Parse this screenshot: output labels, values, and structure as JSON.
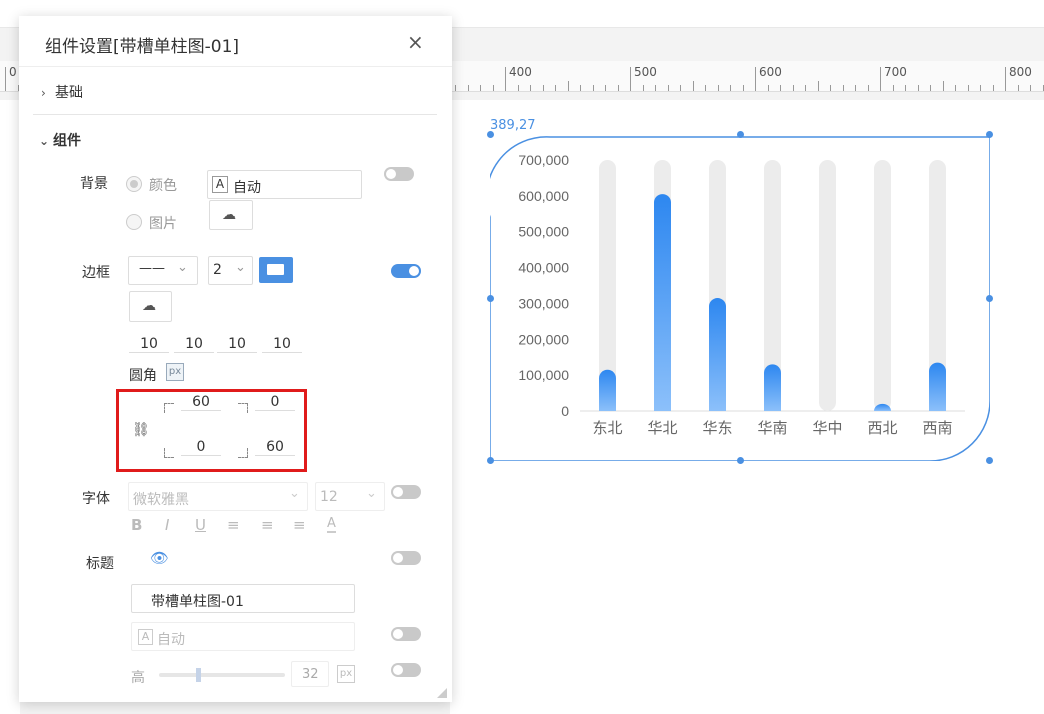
{
  "panel": {
    "title": "组件设置[带槽单柱图-01]",
    "close": "×",
    "section_basic": "基础",
    "section_component": "组件",
    "background": {
      "label": "背景",
      "opt_color": "颜色",
      "opt_image": "图片",
      "color_prefix": "A",
      "color_value": "自动"
    },
    "border": {
      "label": "边框",
      "style_value": "——",
      "width_value": "2",
      "padding": [
        "10",
        "10",
        "10",
        "10"
      ],
      "radius_label": "圆角",
      "unit": "px",
      "radius": {
        "top_left": "60",
        "top_right": "0",
        "bottom_left": "0",
        "bottom_right": "60"
      }
    },
    "font": {
      "label": "字体",
      "family": "微软雅黑",
      "size": "12",
      "format_buttons": [
        "B",
        "I",
        "U",
        "≡",
        "≡",
        "≡",
        "A"
      ]
    },
    "title_section": {
      "label": "标题",
      "value": "带槽单柱图-01",
      "color_prefix": "A",
      "color_value": "自动",
      "height_label": "高",
      "height_value": "32",
      "unit": "px"
    }
  },
  "ruler": {
    "labels": [
      "0",
      "400",
      "500",
      "600",
      "700",
      "800"
    ]
  },
  "widget": {
    "coord_readout": "389,27"
  },
  "chart_data": {
    "type": "bar",
    "categories": [
      "东北",
      "华北",
      "华东",
      "华南",
      "华中",
      "西北",
      "西南"
    ],
    "values": [
      115000,
      605000,
      315000,
      130000,
      0,
      20000,
      135000
    ],
    "ylim": [
      0,
      700000
    ],
    "yticks": [
      "0",
      "100,000",
      "200,000",
      "300,000",
      "400,000",
      "500,000",
      "600,000",
      "700,000"
    ],
    "track_color": "#ececec",
    "bar_color_top": "#2d87f0",
    "bar_color_bottom": "#8cc0fa",
    "grid": false,
    "legend": "none"
  }
}
